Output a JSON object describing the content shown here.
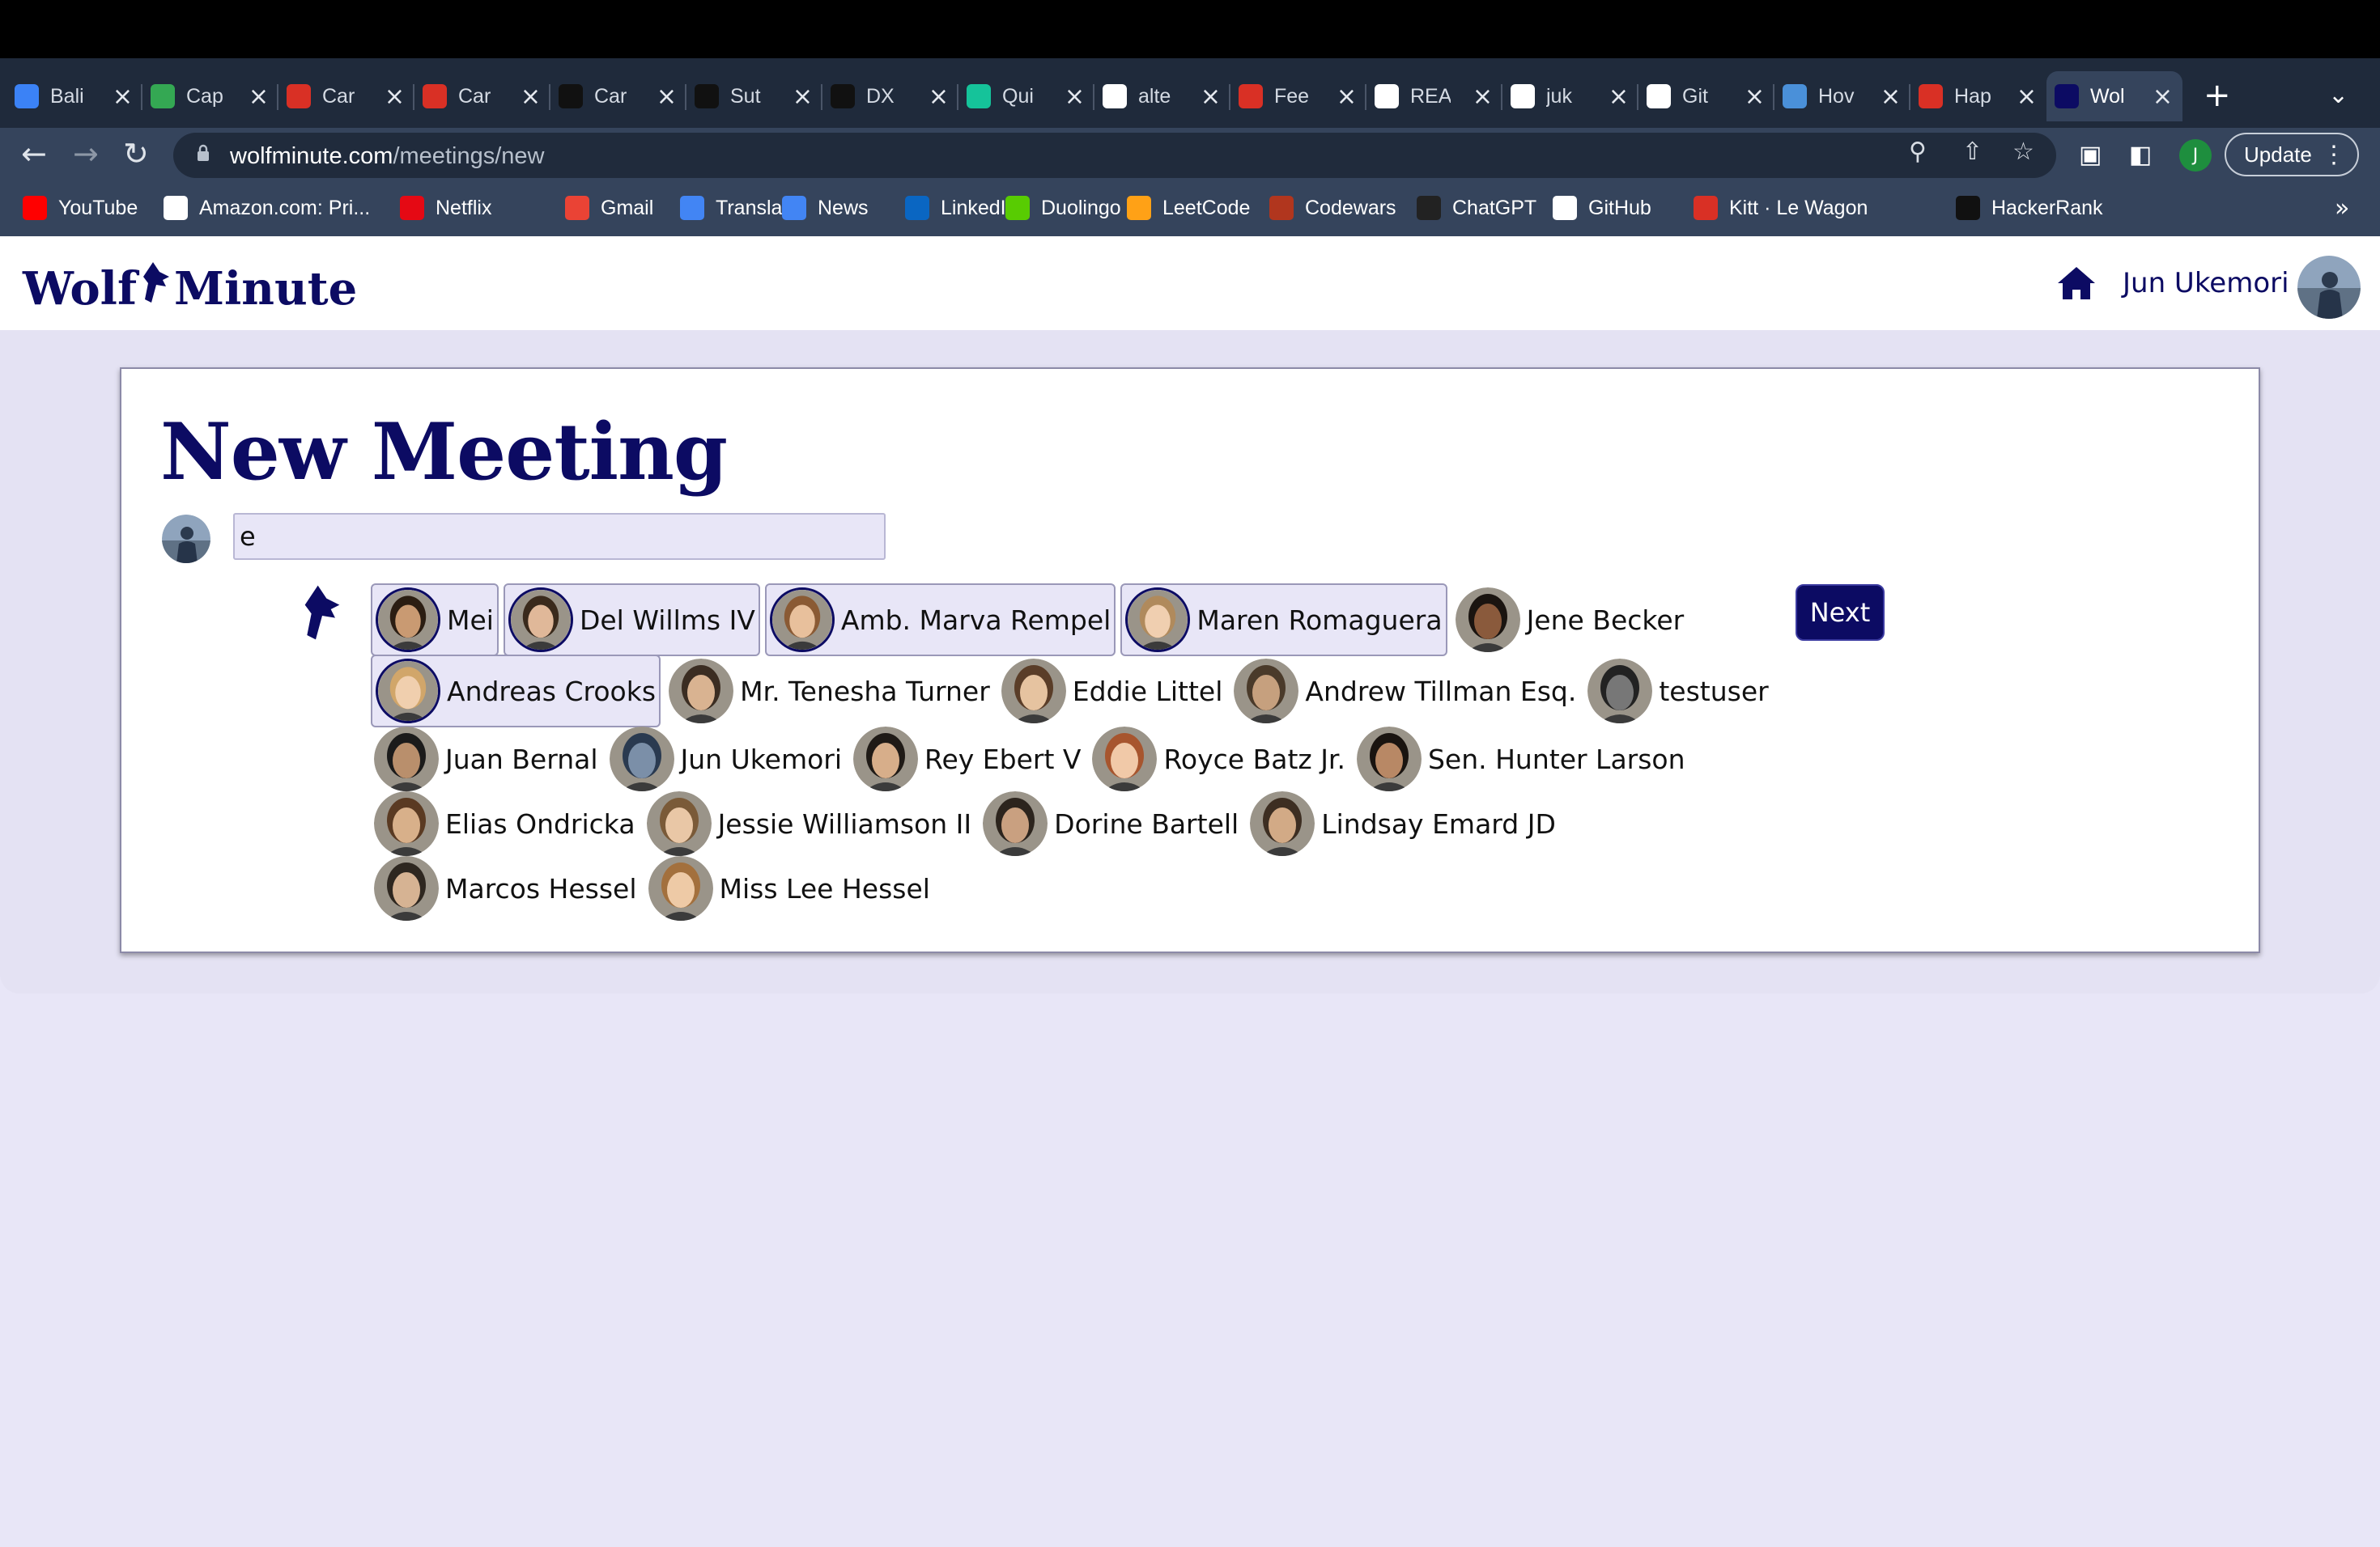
{
  "browser": {
    "tabs": [
      {
        "title": "Bali",
        "icon": "plane-icon",
        "color": "#3b82f6"
      },
      {
        "title": "Cap",
        "icon": "map-pin-icon",
        "color": "#34a853"
      },
      {
        "title": "Car",
        "icon": "bus-icon",
        "color": "#d93025"
      },
      {
        "title": "Car",
        "icon": "bus-icon",
        "color": "#d93025"
      },
      {
        "title": "Car",
        "icon": "notion-icon",
        "color": "#111111"
      },
      {
        "title": "Sut",
        "icon": "blackwhite-icon",
        "color": "#111111"
      },
      {
        "title": "DX",
        "icon": "blackwhite-icon",
        "color": "#111111"
      },
      {
        "title": "Qui",
        "icon": "grammarly-icon",
        "color": "#15c39a"
      },
      {
        "title": "alte",
        "icon": "google-icon",
        "color": "#ffffff"
      },
      {
        "title": "Fee",
        "icon": "bus-icon",
        "color": "#d93025"
      },
      {
        "title": "REA",
        "icon": "github-icon",
        "color": "#ffffff"
      },
      {
        "title": "juk",
        "icon": "github-icon",
        "color": "#ffffff"
      },
      {
        "title": "Git",
        "icon": "github-icon",
        "color": "#ffffff"
      },
      {
        "title": "Hov",
        "icon": "m-icon",
        "color": "#4a90d9"
      },
      {
        "title": "Hap",
        "icon": "heart-icon",
        "color": "#d93025"
      },
      {
        "title": "Wol",
        "icon": "wolf-icon",
        "color": "#0c0b63"
      }
    ],
    "address": {
      "domain": "wolfminute.com",
      "path": "/meetings/new"
    },
    "profile_initial": "J",
    "update_label": "Update",
    "bookmarks": [
      {
        "label": "YouTube",
        "icon": "youtube-icon",
        "color": "#ff0000"
      },
      {
        "label": "Amazon.com: Pri...",
        "icon": "amazon-icon",
        "color": "#ffffff"
      },
      {
        "label": "Netflix",
        "icon": "netflix-icon",
        "color": "#e50914"
      },
      {
        "label": "Gmail",
        "icon": "gmail-icon",
        "color": "#ea4335"
      },
      {
        "label": "Translate",
        "icon": "translate-icon",
        "color": "#4285f4"
      },
      {
        "label": "News",
        "icon": "news-icon",
        "color": "#4285f4"
      },
      {
        "label": "LinkedIn",
        "icon": "linkedin-icon",
        "color": "#0a66c2"
      },
      {
        "label": "Duolingo",
        "icon": "duolingo-icon",
        "color": "#58cc02"
      },
      {
        "label": "LeetCode",
        "icon": "leetcode-icon",
        "color": "#ffa116"
      },
      {
        "label": "Codewars",
        "icon": "codewars-icon",
        "color": "#b1361e"
      },
      {
        "label": "ChatGPT",
        "icon": "chatgpt-icon",
        "color": "#222222"
      },
      {
        "label": "GitHub",
        "icon": "github-icon",
        "color": "#ffffff"
      },
      {
        "label": "Kitt · Le Wagon",
        "icon": "kitt-icon",
        "color": "#d93025"
      },
      {
        "label": "HackerRank",
        "icon": "hackerrank-icon",
        "color": "#111111"
      }
    ]
  },
  "app": {
    "logo_left": "Wolf",
    "logo_right": "Minute",
    "brand_color": "#0c0b63",
    "user_name": "Jun Ukemori"
  },
  "form": {
    "title": "New Meeting",
    "search_value": "e",
    "next_label": "Next"
  },
  "attendees": [
    [
      {
        "name": "Mei",
        "selected": true,
        "skin": "#c99a72",
        "hair": "#2b1d12"
      },
      {
        "name": "Del Willms IV",
        "selected": true,
        "skin": "#e0b899",
        "hair": "#3a2a1c"
      },
      {
        "name": "Amb. Marva Rempel",
        "selected": true,
        "skin": "#e8c09c",
        "hair": "#8a5a34"
      },
      {
        "name": "Maren Romaguera",
        "selected": true,
        "skin": "#f0cfb0",
        "hair": "#b08a5c"
      },
      {
        "name": "Jene Becker",
        "selected": false,
        "skin": "#8a5a3c",
        "hair": "#1a1410"
      }
    ],
    [
      {
        "name": "Andreas Crooks",
        "selected": true,
        "skin": "#f0cfae",
        "hair": "#d1a66a"
      },
      {
        "name": "Mr. Tenesha Turner",
        "selected": false,
        "skin": "#d9b391",
        "hair": "#3b2d22"
      },
      {
        "name": "Eddie Littel",
        "selected": false,
        "skin": "#e6c3a0",
        "hair": "#5a3d28"
      },
      {
        "name": "Andrew Tillman Esq.",
        "selected": false,
        "skin": "#c6a07e",
        "hair": "#4a3a2a"
      },
      {
        "name": "testuser",
        "selected": false,
        "skin": "#777777",
        "hair": "#222222"
      }
    ],
    [
      {
        "name": "Juan Bernal",
        "selected": false,
        "skin": "#b98f6c",
        "hair": "#1b1b1b"
      },
      {
        "name": "Jun Ukemori",
        "selected": false,
        "skin": "#7b8fa8",
        "hair": "#2a3a50"
      },
      {
        "name": "Rey Ebert V",
        "selected": false,
        "skin": "#d7ae8a",
        "hair": "#1f1a16"
      },
      {
        "name": "Royce Batz Jr.",
        "selected": false,
        "skin": "#f1c9a8",
        "hair": "#a7552e"
      },
      {
        "name": "Sen. Hunter Larson",
        "selected": false,
        "skin": "#b88865",
        "hair": "#1a1410"
      }
    ],
    [
      {
        "name": "Elias Ondricka",
        "selected": false,
        "skin": "#d8b08a",
        "hair": "#5a3a22"
      },
      {
        "name": "Jessie Williamson II",
        "selected": false,
        "skin": "#e9c7a6",
        "hair": "#7a5a38"
      },
      {
        "name": "Dorine Bartell",
        "selected": false,
        "skin": "#c9a080",
        "hair": "#2c241d"
      },
      {
        "name": "Lindsay Emard JD",
        "selected": false,
        "skin": "#d2aa86",
        "hair": "#3d2e22"
      }
    ],
    [
      {
        "name": "Marcos Hessel",
        "selected": false,
        "skin": "#d6b393",
        "hair": "#2e2720"
      },
      {
        "name": "Miss Lee Hessel",
        "selected": false,
        "skin": "#eecaa6",
        "hair": "#a3703d"
      }
    ]
  ]
}
